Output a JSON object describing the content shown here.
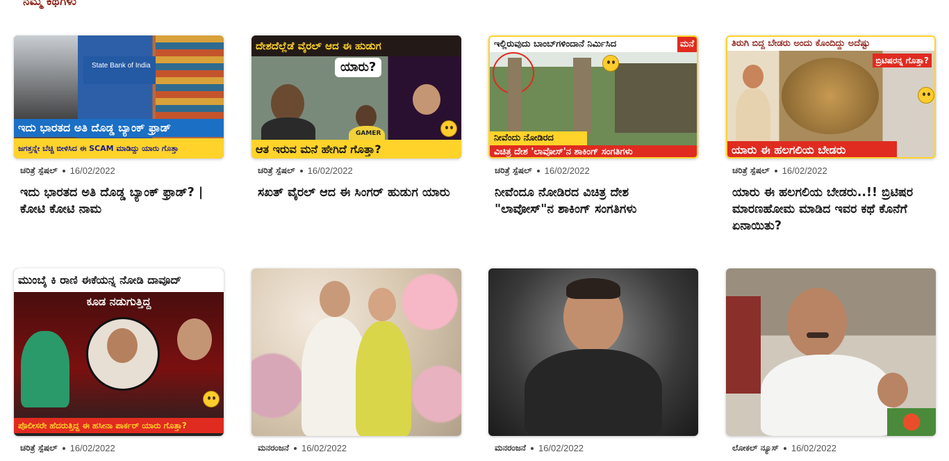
{
  "section": {
    "title": "ನಮ್ಮ ಕಥೆಗಳು"
  },
  "cards": [
    {
      "thumb_lines": [
        "ಇದು ಭಾರತದ ಅತಿ ದೊಡ್ಡ ಬ್ಯಾಂಕ್ ಫ್ರಾಡ್",
        "ಜಗತ್ತನ್ನೇ ಬೆಚ್ಚಿ ಬೀಳಿಸಿದ ಈ SCAM ಮಾಡಿದ್ದು ಯಾರು ಗೊತ್ತಾ",
        "State Bank of India"
      ],
      "category": "ಚರಿತ್ರೆ ಸ್ಪೆಷಲ್",
      "date": "16/02/2022",
      "headline": "ಇದು ಭಾರತದ ಅತಿ ದೊಡ್ಡ ಬ್ಯಾಂಕ್ ಫ್ರಾಡ್? | ಕೋಟಿ ಕೋಟಿ ನಾಮ"
    },
    {
      "thumb_lines": [
        "ದೇಶದೆಲ್ಲೆಡೆ ವೈರಲ್ ಆದ ಈ ಹುಡುಗ",
        "ಯಾರು?",
        "ಆತ ಇರುವ ಮನೆ ಹೇಗಿದೆ ಗೊತ್ತಾ?",
        "GAMER"
      ],
      "category": "ಚರಿತ್ರೆ ಸ್ಪೆಷಲ್",
      "date": "16/02/2022",
      "headline": "ಸಖತ್ ವೈರಲ್ ಆದ ಈ ಸಿಂಗರ್ ಹುಡುಗ ಯಾರು"
    },
    {
      "thumb_lines": [
        "ಇಲ್ಲಿರುವುದು ಬಾಂಬ್‌ಗಳಿಂದಾನೆ ನಿರ್ಮಿಸಿದ",
        "ಮನೆ",
        "ನೀವೆಂದು ನೋಡಿರದ",
        "ವಿಚಿತ್ರ ದೇಶ 'ಲಾವೋಸ್'ನ ಶಾಕಿಂಗ್ ಸಂಗತಿಗಳು"
      ],
      "category": "ಚರಿತ್ರೆ ಸ್ಪೆಷಲ್",
      "date": "16/02/2022",
      "headline": "ನೀವೆಂದೂ ನೋಡಿರದ ವಿಚಿತ್ರ ದೇಶ \"ಲಾವೋಸ್\"ನ ಶಾಕಿಂಗ್ ಸಂಗತಿಗಳು"
    },
    {
      "thumb_lines": [
        "ತಿರುಗಿ ಬಿದ್ದ ಬೇಡರು ಅಂದು ಕೊಂದಿದ್ದು ಅದೆಷ್ಟು",
        "ಬ್ರಿಟಿಷರನ್ನ ಗೊತ್ತಾ?",
        "ಯಾರು ಈ ಹಲಗಲಿಯ ಬೇಡರು"
      ],
      "category": "ಚರಿತ್ರೆ ಸ್ಪೆಷಲ್",
      "date": "16/02/2022",
      "headline": "ಯಾರು ಈ ಹಲಗಲಿಯ ಬೇಡರು..!! ಬ್ರಿಟಿಷರ ಮಾರಣಹೋಮ ಮಾಡಿದ ಇವರ ಕಥೆ ಕೊನೆಗೆ ಏನಾಯಿತು?"
    },
    {
      "thumb_lines": [
        "ಮುಂಬೈ ಕಿ ರಾಣಿ ಈಕೆಯನ್ನ ನೋಡಿ ದಾವೂದ್",
        "ಕೂಡ ನಡುಗುತ್ತಿದ್ದ",
        "ಪೊಲೀಸರೇ ಹೆದರುತ್ತಿದ್ದ ಈ ಹಸೀನಾ ಪಾರ್ಕರ್ ಯಾರು ಗೊತ್ತಾ?"
      ],
      "category": "ಚರಿತ್ರೆ ಸ್ಪೆಷಲ್",
      "date": "16/02/2022",
      "headline": ""
    },
    {
      "thumb_lines": [],
      "category": "ಮನರಂಜನೆ",
      "date": "16/02/2022",
      "headline": ""
    },
    {
      "thumb_lines": [],
      "category": "ಮನರಂಜನೆ",
      "date": "16/02/2022",
      "headline": ""
    },
    {
      "thumb_lines": [],
      "category": "ಲೋಕಲ್ ನ್ಯೂಸ್",
      "date": "16/02/2022",
      "headline": ""
    }
  ],
  "colors": {
    "section_title": "#8b1c13",
    "banner_blue": "#1b6fc4",
    "banner_yellow": "#ffd32a",
    "banner_red": "#e02b20"
  }
}
